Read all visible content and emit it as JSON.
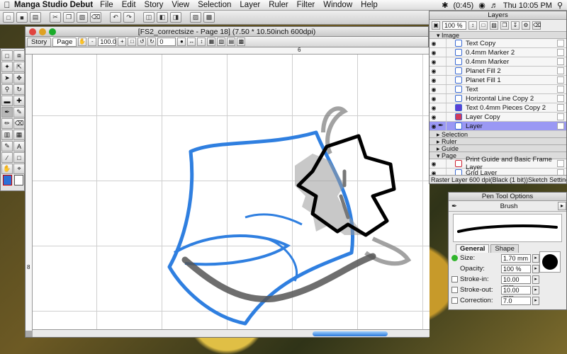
{
  "menubar": {
    "apple": "",
    "app_name": "Manga Studio Debut",
    "items": [
      "File",
      "Edit",
      "Story",
      "View",
      "Selection",
      "Layer",
      "Ruler",
      "Filter",
      "Window",
      "Help"
    ],
    "battery": "(0:45)",
    "clock": "Thu 10:05 PM"
  },
  "document": {
    "title": "[FS2_correctsize - Page 18] (7.50 * 10.50inch 600dpi)",
    "tabs": [
      "Story",
      "Page"
    ],
    "zoom": "100.0",
    "rotation": "0",
    "ruler_h_mark": "6",
    "ruler_v_mark": "8"
  },
  "layers": {
    "title": "Layers",
    "opacity": "100 %",
    "group_image": "Image",
    "rows": [
      {
        "name": "Text Copy",
        "selected": false
      },
      {
        "name": "0.4mm Marker 2",
        "selected": false
      },
      {
        "name": "0.4mm Marker",
        "selected": false
      },
      {
        "name": "Planet Fill 2",
        "selected": false
      },
      {
        "name": "Planet Fill 1",
        "selected": false
      },
      {
        "name": "Text",
        "selected": false
      },
      {
        "name": "Horizontal Line Copy 2",
        "selected": false
      },
      {
        "name": "Text 0.4mm Pieces Copy 2",
        "selected": false
      },
      {
        "name": "Layer Copy",
        "selected": false
      },
      {
        "name": "Layer",
        "selected": true
      }
    ],
    "groups": [
      "Selection",
      "Ruler",
      "Guide",
      "Page"
    ],
    "page_rows": [
      "Print Guide and Basic Frame Layer",
      "Grid Layer"
    ],
    "status": "Raster Layer 600 dpi(Black (1 bit))Sketch Settings"
  },
  "pen": {
    "title": "Pen Tool Options",
    "brush": "Brush",
    "tabs": [
      "General",
      "Shape"
    ],
    "size_label": "Size:",
    "size": "1.70 mm",
    "opacity_label": "Opacity:",
    "opacity": "100 %",
    "stroke_in_label": "Stroke-in:",
    "stroke_in": "10.00 mm",
    "stroke_out_label": "Stroke-out:",
    "stroke_out": "10.00 mm",
    "correction_label": "Correction:",
    "correction": "7.0"
  },
  "colors": {
    "accent": "#9a98f4",
    "layer_selected": "#9a98f4",
    "sketch_blue": "#2f7fe0"
  }
}
